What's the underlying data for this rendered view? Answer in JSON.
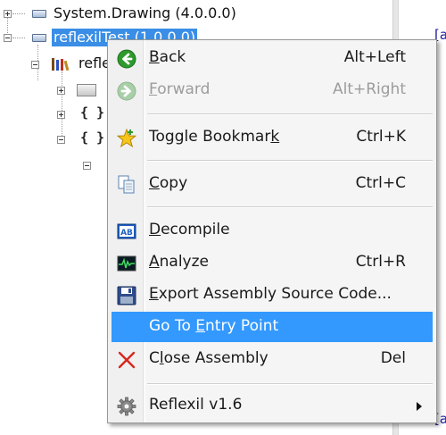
{
  "tree": {
    "items": [
      {
        "label": "System.Drawing (4.0.0.0)"
      },
      {
        "label": "reflexilTest (1.0.0.0)"
      },
      {
        "label": "refle"
      }
    ],
    "braces": "{ }",
    "fragments": [
      "[a",
      "[a"
    ]
  },
  "menu": {
    "items": [
      {
        "pre": "",
        "accel": "B",
        "post": "ack",
        "shortcut": "Alt+Left",
        "icon": "back-arrow-icon"
      },
      {
        "pre": "",
        "accel": "F",
        "post": "orward",
        "shortcut": "Alt+Right",
        "icon": "forward-arrow-icon"
      },
      {
        "pre": "Toggle Bookmar",
        "accel": "k",
        "post": "",
        "shortcut": "Ctrl+K",
        "icon": "bookmark-star-icon"
      },
      {
        "pre": "",
        "accel": "C",
        "post": "opy",
        "shortcut": "Ctrl+C",
        "icon": "copy-icon"
      },
      {
        "pre": "",
        "accel": "D",
        "post": "ecompile",
        "shortcut": "",
        "icon": "decompile-icon",
        "icon_text": "AB"
      },
      {
        "pre": "",
        "accel": "A",
        "post": "nalyze",
        "shortcut": "Ctrl+R",
        "icon": "analyze-icon"
      },
      {
        "pre": "",
        "accel": "E",
        "post": "xport Assembly Source Code...",
        "shortcut": "",
        "icon": "floppy-disk-icon"
      },
      {
        "pre": "Go To ",
        "accel": "E",
        "post": "ntry Point",
        "shortcut": "",
        "icon": ""
      },
      {
        "pre": "C",
        "accel": "l",
        "post": "ose Assembly",
        "shortcut": "Del",
        "icon": "close-x-icon"
      },
      {
        "pre": "Reflexil v1.6",
        "accel": "",
        "post": "",
        "shortcut": "",
        "icon": "gear-icon"
      }
    ]
  },
  "colors": {
    "highlight": "#3399ff",
    "tree_selection": "#3a8ee6",
    "disabled_text": "#9c9c9c",
    "back_green": "#2e9a2e",
    "close_red": "#d9261c"
  }
}
